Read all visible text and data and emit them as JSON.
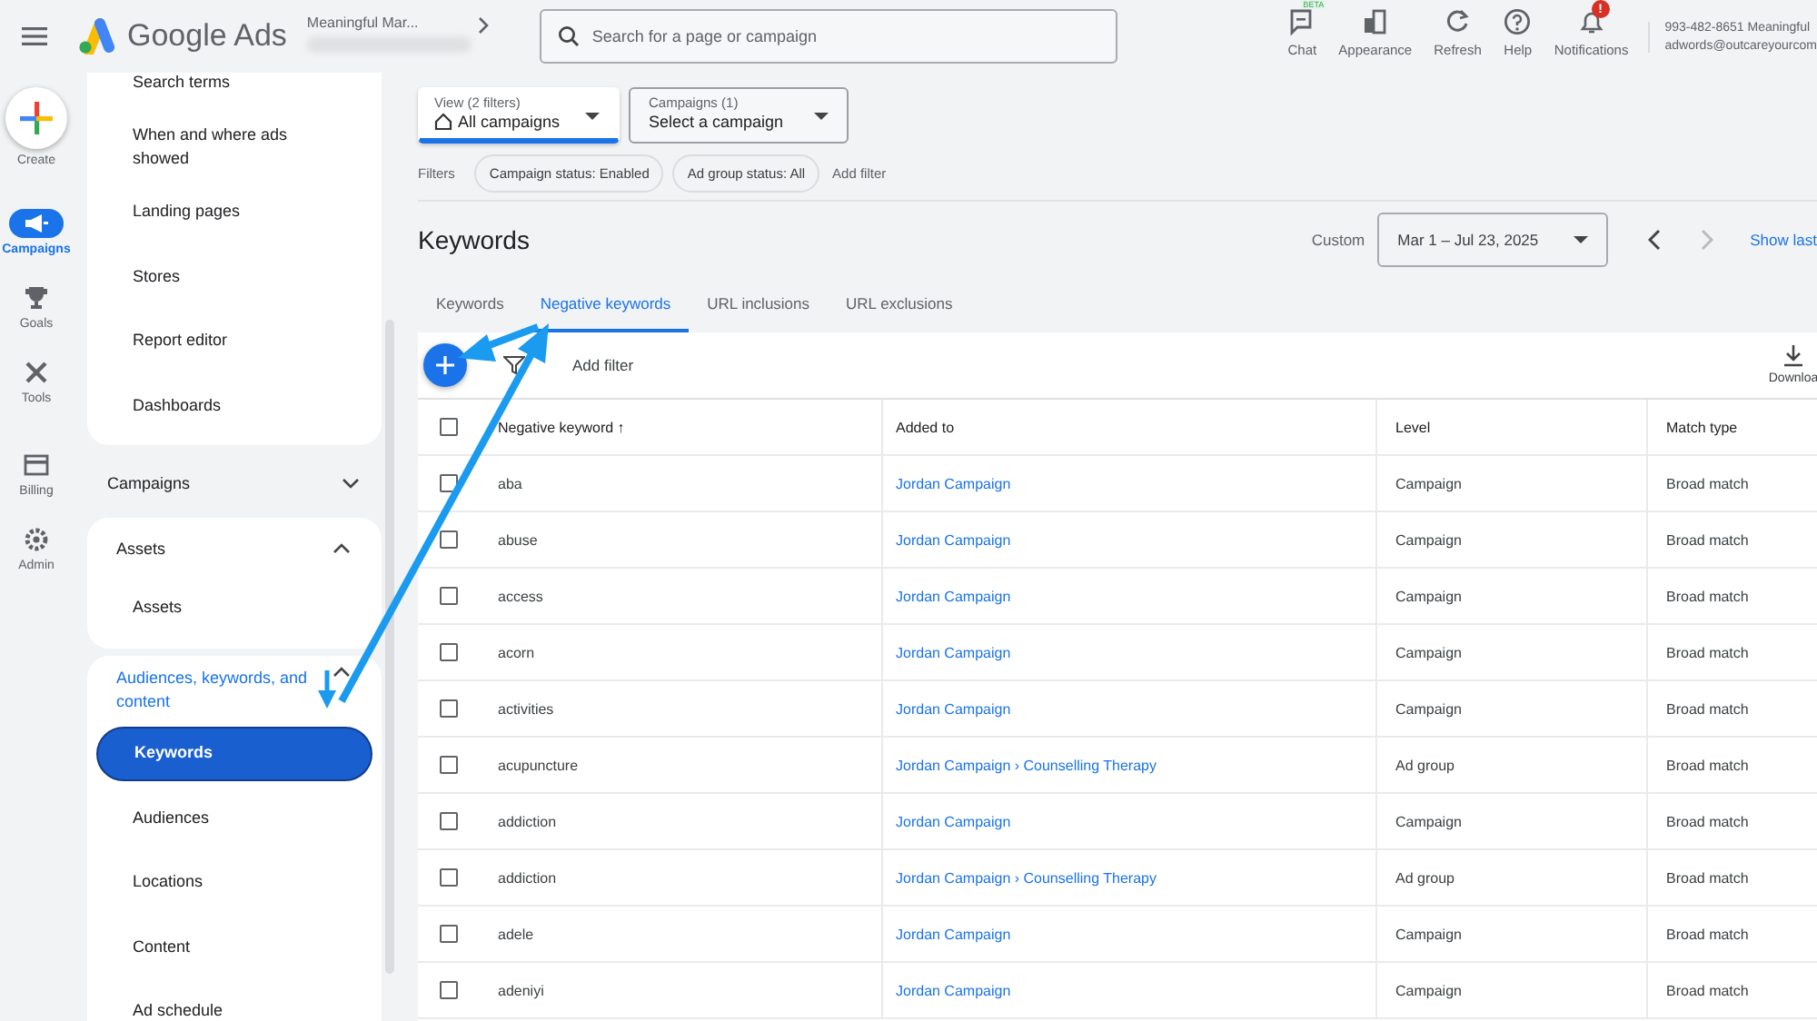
{
  "topbar": {
    "app_name": "Google Ads",
    "account": "Meaningful Mar...",
    "search": {
      "placeholder": "Search for a page or campaign"
    },
    "actions": [
      {
        "kind": "chat",
        "label": "Chat",
        "badge": "BETA"
      },
      {
        "kind": "appearance",
        "label": "Appearance"
      },
      {
        "kind": "refresh",
        "label": "Refresh"
      },
      {
        "kind": "help",
        "label": "Help"
      },
      {
        "kind": "notifications",
        "label": "Notifications",
        "badge": "!"
      }
    ],
    "customer": {
      "line_1": "993-482-8651 Meaningful",
      "line_2": "adwords@outcareyourcom"
    }
  },
  "rail": [
    {
      "kind": "create",
      "label": "Create",
      "selected": false
    },
    {
      "kind": "campaigns",
      "label": "Campaigns",
      "selected": true
    },
    {
      "kind": "goals",
      "label": "Goals",
      "selected": false
    },
    {
      "kind": "tools",
      "label": "Tools",
      "selected": false
    },
    {
      "kind": "billing",
      "label": "Billing",
      "selected": false
    },
    {
      "kind": "admin",
      "label": "Admin",
      "selected": false
    }
  ],
  "sidebar": {
    "sections": [
      {
        "items": [
          {
            "label": "Search terms",
            "selected": false
          },
          {
            "label": "When and where ads showed",
            "selected": false
          },
          {
            "label": "Landing pages",
            "selected": false
          },
          {
            "label": "Stores",
            "selected": false
          },
          {
            "label": "Report editor",
            "selected": false
          },
          {
            "label": "Dashboards",
            "selected": false
          }
        ]
      },
      {
        "title": "Campaigns",
        "expanded": false
      },
      {
        "title": "Assets",
        "expanded": true,
        "items": [
          {
            "label": "Assets",
            "selected": false
          }
        ]
      },
      {
        "title": "Audiences, keywords, and content",
        "expanded": true,
        "items": [
          {
            "label": "Keywords",
            "selected": true
          },
          {
            "label": "Audiences",
            "selected": false
          },
          {
            "label": "Locations",
            "selected": false
          },
          {
            "label": "Content",
            "selected": false
          },
          {
            "label": "Ad schedule",
            "selected": false
          }
        ]
      }
    ]
  },
  "view_picker": {
    "label": "View (2 filters)",
    "value": "All campaigns"
  },
  "campaign_picker": {
    "label": "Campaigns (1)",
    "value": "Select a campaign"
  },
  "filters": {
    "label": "Filters",
    "chips": [
      "Campaign status: Enabled",
      "Ad group status: All"
    ],
    "add": "Add filter"
  },
  "page_title": "Keywords",
  "date": {
    "label": "Custom",
    "range": "Mar 1 – Jul 23, 2025",
    "show_last": "Show last"
  },
  "tabs": [
    {
      "label": "Keywords",
      "selected": false
    },
    {
      "label": "Negative keywords",
      "selected": true
    },
    {
      "label": "URL inclusions",
      "selected": false
    },
    {
      "label": "URL exclusions",
      "selected": false
    }
  ],
  "toolbar": {
    "add_filter": "Add filter",
    "download": "Downloa"
  },
  "table": {
    "header_checked": false,
    "columns": [
      "Negative keyword ↑",
      "Added to",
      "Level",
      "Match type"
    ],
    "rows": [
      {
        "checked": false,
        "cells": [
          "aba",
          "Jordan Campaign",
          "Campaign",
          "Broad match"
        ]
      },
      {
        "checked": false,
        "cells": [
          "abuse",
          "Jordan Campaign",
          "Campaign",
          "Broad match"
        ]
      },
      {
        "checked": false,
        "cells": [
          "access",
          "Jordan Campaign",
          "Campaign",
          "Broad match"
        ]
      },
      {
        "checked": false,
        "cells": [
          "acorn",
          "Jordan Campaign",
          "Campaign",
          "Broad match"
        ]
      },
      {
        "checked": false,
        "cells": [
          "activities",
          "Jordan Campaign",
          "Campaign",
          "Broad match"
        ]
      },
      {
        "checked": false,
        "cells": [
          "acupuncture",
          "Jordan Campaign › Counselling Therapy",
          "Ad group",
          "Broad match"
        ]
      },
      {
        "checked": false,
        "cells": [
          "addiction",
          "Jordan Campaign",
          "Campaign",
          "Broad match"
        ]
      },
      {
        "checked": false,
        "cells": [
          "addiction",
          "Jordan Campaign › Counselling Therapy",
          "Ad group",
          "Broad match"
        ]
      },
      {
        "checked": false,
        "cells": [
          "adele",
          "Jordan Campaign",
          "Campaign",
          "Broad match"
        ]
      },
      {
        "checked": false,
        "cells": [
          "adeniyi",
          "Jordan Campaign",
          "Campaign",
          "Broad match"
        ]
      }
    ]
  }
}
